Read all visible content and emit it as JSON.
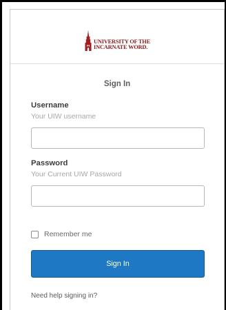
{
  "brand": {
    "line1": "UNIVERSITY OF THE",
    "line2": "INCARNATE WORD.",
    "color": "#8c1a1a"
  },
  "form": {
    "title": "Sign In",
    "username": {
      "label": "Username",
      "hint": "Your UIW username",
      "value": ""
    },
    "password": {
      "label": "Password",
      "hint": "Your Current UIW Password",
      "value": ""
    },
    "remember_label": "Remember me",
    "remember_checked": false,
    "submit_label": "Sign In",
    "help_link": "Need help signing in?"
  },
  "colors": {
    "button": "#1e78c4",
    "border": "#c6c6c6"
  }
}
